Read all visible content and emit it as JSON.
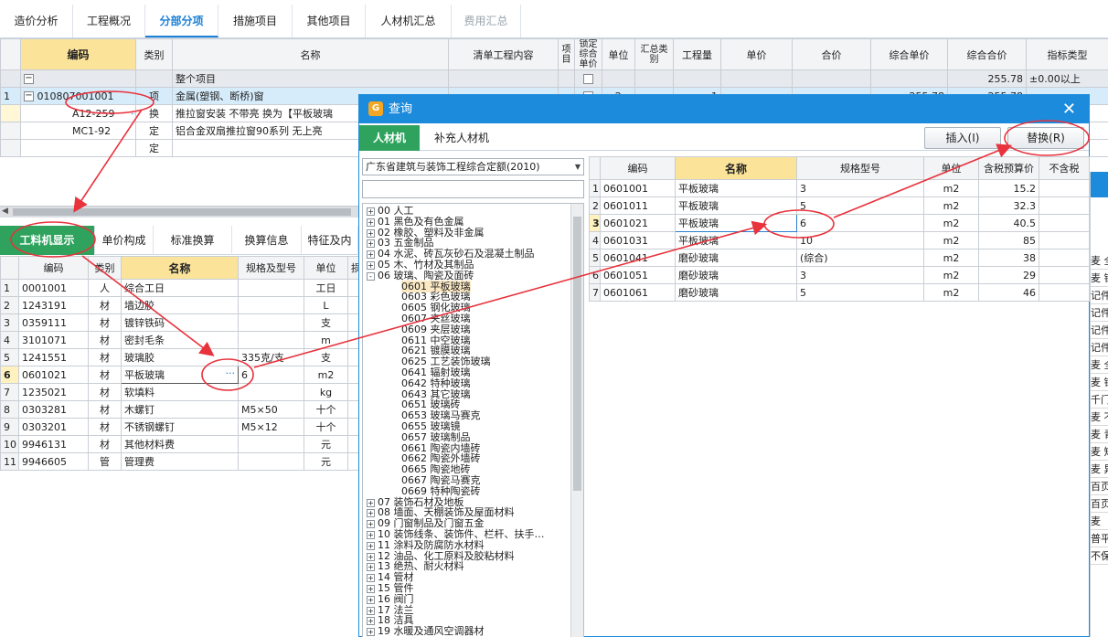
{
  "top_tabs": [
    {
      "label": "造价分析"
    },
    {
      "label": "工程概况"
    },
    {
      "label": "分部分项"
    },
    {
      "label": "措施项目"
    },
    {
      "label": "其他项目"
    },
    {
      "label": "人材机汇总"
    },
    {
      "label": "费用汇总"
    }
  ],
  "main_grid": {
    "headers": [
      "编码",
      "类别",
      "名称",
      "清单工程内容",
      "项目",
      "锁定综合单价",
      "单位",
      "汇总类别",
      "工程量",
      "单价",
      "合价",
      "综合单价",
      "综合合价",
      "指标类型"
    ],
    "total_row": {
      "name": "整个项目",
      "amount": "255.78",
      "index_type": "±0.00以上"
    },
    "rows": [
      {
        "num": "1",
        "code": "010807001001",
        "type": "项",
        "name": "金属(塑钢、断桥)窗",
        "unit": "m2",
        "qty": "1",
        "comp_price": "255.78",
        "comp_total": "255.78"
      },
      {
        "num": "",
        "code": "A12-259",
        "dots": "···",
        "type": "换",
        "name": "推拉窗安装 不带亮  换为【平板玻璃"
      },
      {
        "num": "",
        "code": "MC1-92",
        "type": "定",
        "name": "铝合金双扇推拉窗90系列 无上亮"
      },
      {
        "num": "",
        "code": "",
        "type": "定",
        "name": ""
      }
    ]
  },
  "sub_tabs": [
    {
      "label": "工料机显示"
    },
    {
      "label": "单价构成"
    },
    {
      "label": "标准换算"
    },
    {
      "label": "换算信息"
    },
    {
      "label": "特征及内"
    }
  ],
  "material_grid": {
    "headers": [
      "编码",
      "类别",
      "名称",
      "规格及型号",
      "单位",
      "损"
    ],
    "rows": [
      {
        "num": "1",
        "code": "0001001",
        "type": "人",
        "name": "综合工日",
        "spec": "",
        "unit": "工日"
      },
      {
        "num": "2",
        "code": "1243191",
        "type": "材",
        "name": "墙边胶",
        "spec": "",
        "unit": "L"
      },
      {
        "num": "3",
        "code": "0359111",
        "type": "材",
        "name": "镀锌铁码",
        "spec": "",
        "unit": "支"
      },
      {
        "num": "4",
        "code": "3101071",
        "type": "材",
        "name": "密封毛条",
        "spec": "",
        "unit": "m"
      },
      {
        "num": "5",
        "code": "1241551",
        "type": "材",
        "name": "玻璃胶",
        "spec": "335克/支",
        "unit": "支"
      },
      {
        "num": "6",
        "code": "0601021",
        "type": "材",
        "name": "平板玻璃",
        "dots": "···",
        "spec": "6",
        "unit": "m2"
      },
      {
        "num": "7",
        "code": "1235021",
        "type": "材",
        "name": "软填料",
        "spec": "",
        "unit": "kg"
      },
      {
        "num": "8",
        "code": "0303281",
        "type": "材",
        "name": "木螺钉",
        "spec": "M5×50",
        "unit": "十个"
      },
      {
        "num": "9",
        "code": "0303201",
        "type": "材",
        "name": "不锈钢螺钉",
        "spec": "M5×12",
        "unit": "十个"
      },
      {
        "num": "10",
        "code": "9946131",
        "type": "材",
        "name": "其他材料费",
        "spec": "",
        "unit": "元"
      },
      {
        "num": "11",
        "code": "9946605",
        "type": "管",
        "name": "管理费",
        "spec": "",
        "unit": "元"
      }
    ]
  },
  "dialog": {
    "title": "查询",
    "close_glyph": "✕",
    "tabs": [
      {
        "label": "人材机"
      },
      {
        "label": "补充人材机"
      }
    ],
    "insert_label": "插入(I)",
    "replace_label": "替换(R)",
    "quota_select": "广东省建筑与装饰工程综合定额(2010)",
    "search_value": "",
    "tree": [
      {
        "pm": "+",
        "label": "00 人工"
      },
      {
        "pm": "+",
        "label": "01 黑色及有色金属"
      },
      {
        "pm": "+",
        "label": "02 橡胶、塑料及非金属"
      },
      {
        "pm": "+",
        "label": "03 五金制品"
      },
      {
        "pm": "+",
        "label": "04 水泥、砖瓦灰砂石及混凝土制品"
      },
      {
        "pm": "+",
        "label": "05 木、竹材及其制品"
      },
      {
        "pm": "-",
        "label": "06 玻璃、陶瓷及面砖"
      },
      {
        "leaf": true,
        "label": "0601 平板玻璃",
        "selected": true
      },
      {
        "leaf": true,
        "label": "0603 彩色玻璃"
      },
      {
        "leaf": true,
        "label": "0605 钢化玻璃"
      },
      {
        "leaf": true,
        "label": "0607 夹丝玻璃"
      },
      {
        "leaf": true,
        "label": "0609 夹层玻璃"
      },
      {
        "leaf": true,
        "label": "0611 中空玻璃"
      },
      {
        "leaf": true,
        "label": "0621 镀膜玻璃"
      },
      {
        "leaf": true,
        "label": "0625 工艺装饰玻璃"
      },
      {
        "leaf": true,
        "label": "0641 辐射玻璃"
      },
      {
        "leaf": true,
        "label": "0642 特种玻璃"
      },
      {
        "leaf": true,
        "label": "0643 其它玻璃"
      },
      {
        "leaf": true,
        "label": "0651 玻璃砖"
      },
      {
        "leaf": true,
        "label": "0653 玻璃马赛克"
      },
      {
        "leaf": true,
        "label": "0655 玻璃镜"
      },
      {
        "leaf": true,
        "label": "0657 玻璃制品"
      },
      {
        "leaf": true,
        "label": "0661 陶瓷内墙砖"
      },
      {
        "leaf": true,
        "label": "0662 陶瓷外墙砖"
      },
      {
        "leaf": true,
        "label": "0665 陶瓷地砖"
      },
      {
        "leaf": true,
        "label": "0667 陶瓷马赛克"
      },
      {
        "leaf": true,
        "label": "0669 特种陶瓷砖"
      },
      {
        "pm": "+",
        "label": "07 装饰石材及地板"
      },
      {
        "pm": "+",
        "label": "08 墙面、天棚装饰及屋面材料"
      },
      {
        "pm": "+",
        "label": "09 门窗制品及门窗五金"
      },
      {
        "pm": "+",
        "label": "10 装饰线条、装饰件、栏杆、扶手…"
      },
      {
        "pm": "+",
        "label": "11 涂料及防腐防水材料"
      },
      {
        "pm": "+",
        "label": "12 油品、化工原料及胶粘材料"
      },
      {
        "pm": "+",
        "label": "13 绝热、耐火材料"
      },
      {
        "pm": "+",
        "label": "14 管材"
      },
      {
        "pm": "+",
        "label": "15 管件"
      },
      {
        "pm": "+",
        "label": "16 阀门"
      },
      {
        "pm": "+",
        "label": "17 法兰"
      },
      {
        "pm": "+",
        "label": "18 洁具"
      },
      {
        "pm": "+",
        "label": "19 水暖及通风空调器材"
      }
    ],
    "result_headers": [
      "编码",
      "名称",
      "规格型号",
      "单位",
      "含税预算价",
      "不含税"
    ],
    "results": [
      {
        "num": "1",
        "code": "0601001",
        "name": "平板玻璃",
        "spec": "3",
        "unit": "m2",
        "price": "15.2"
      },
      {
        "num": "2",
        "code": "0601011",
        "name": "平板玻璃",
        "spec": "5",
        "unit": "m2",
        "price": "32.3"
      },
      {
        "num": "3",
        "code": "0601021",
        "name": "平板玻璃",
        "spec": "6",
        "unit": "m2",
        "price": "40.5"
      },
      {
        "num": "4",
        "code": "0601031",
        "name": "平板玻璃",
        "spec": "10",
        "unit": "m2",
        "price": "85"
      },
      {
        "num": "5",
        "code": "0601041",
        "name": "磨砂玻璃",
        "spec": "(综合)",
        "unit": "m2",
        "price": "38"
      },
      {
        "num": "6",
        "code": "0601051",
        "name": "磨砂玻璃",
        "spec": "3",
        "unit": "m2",
        "price": "29"
      },
      {
        "num": "7",
        "code": "0601061",
        "name": "磨砂玻璃",
        "spec": "5",
        "unit": "m2",
        "price": "46"
      }
    ]
  },
  "right_strip": [
    "麦 全",
    "麦 钢",
    "记件",
    "记件",
    "记件",
    "记件",
    "麦 全",
    "麦 钢",
    "千门",
    "麦 不",
    "麦 青",
    "麦 矩",
    "麦 异",
    "百页",
    "百页",
    "麦",
    "普平",
    "不保"
  ],
  "colors": {
    "accent": "#1c8bdc",
    "green_tab": "#2fa35d",
    "header_highlight": "#fbe39a",
    "annotation": "#e8323c"
  }
}
